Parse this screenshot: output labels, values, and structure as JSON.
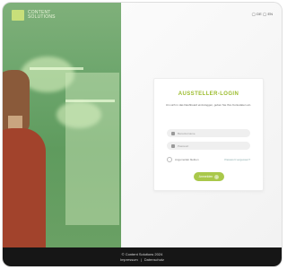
{
  "brand": {
    "line1": "CONTENT",
    "line2": "SOLUTIONS",
    "accent_color": "#a9c84a"
  },
  "lang_switch": "◯ DE ◯ EN",
  "login": {
    "title": "AUSSTELLER-LOGIN",
    "description": "Um sich in das Dashboard einzuloggen, geben Sie Ihre Kontodaten ein.",
    "username_placeholder": "Benutzername",
    "password_placeholder": "Passwort",
    "remember_label": "Angemeldet bleiben",
    "forgot_label": "Passwort vergessen?",
    "submit_label": "Anmelden"
  },
  "footer": {
    "copyright": "© Content Solutions 2024",
    "link_imprint": "Impressum",
    "separator": "|",
    "link_privacy": "Datenschutz"
  }
}
